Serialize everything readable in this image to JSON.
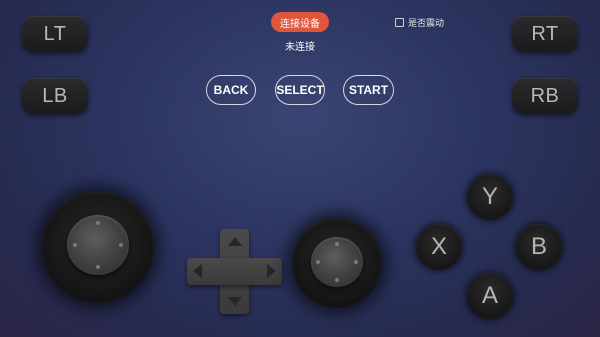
{
  "shoulders": {
    "lt": "LT",
    "lb": "LB",
    "rt": "RT",
    "rb": "RB"
  },
  "header": {
    "connect_label": "连接设备",
    "status": "未连接",
    "vibrate_label": "是否震动",
    "vibrate_checked": false
  },
  "center_buttons": {
    "back": "BACK",
    "select": "SELECT",
    "start": "START"
  },
  "face_buttons": {
    "y": "Y",
    "x": "X",
    "b": "B",
    "a": "A"
  },
  "colors": {
    "accent": "#e0563c",
    "background": "#2b3460"
  },
  "icons": {
    "dpad_up": "triangle-up",
    "dpad_down": "triangle-down",
    "dpad_left": "triangle-left",
    "dpad_right": "triangle-right"
  }
}
